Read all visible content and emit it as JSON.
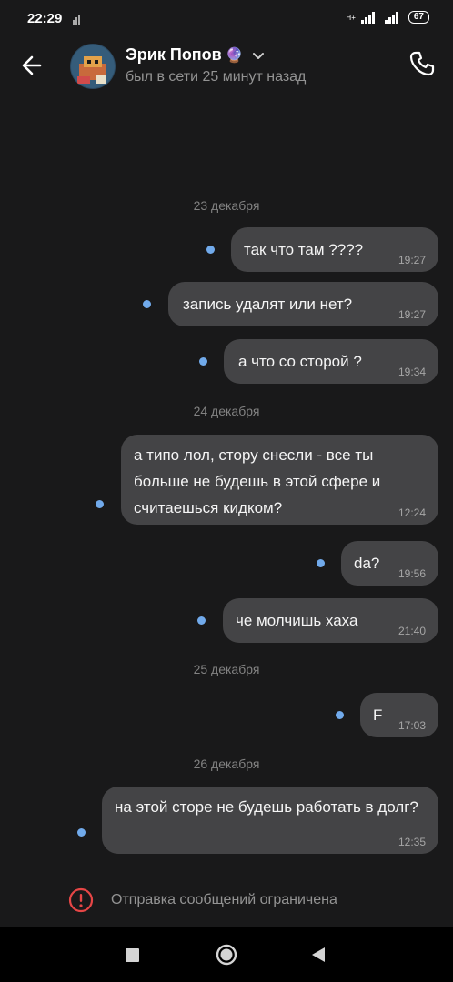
{
  "status_bar": {
    "time": "22:29",
    "network_small": "H+",
    "battery": "67"
  },
  "header": {
    "contact_name": "Эрик Попов",
    "contact_emoji": "🔮",
    "last_seen": "был в сети 25 минут назад",
    "icons": [
      "arrow-back-icon",
      "avatar",
      "chevron-down-icon",
      "phone-icon"
    ]
  },
  "chat": {
    "dates": [
      "23 декабря",
      "24 декабря",
      "25 декабря",
      "26 декабря"
    ],
    "messages": [
      {
        "text": "так что там ????",
        "time": "19:27",
        "unread": true
      },
      {
        "text": "запись удалят или нет?",
        "time": "19:27",
        "unread": true
      },
      {
        "text": "а что со сторой ?",
        "time": "19:34",
        "unread": true
      },
      {
        "text": "а типо лол, стору снесли - все ты больше не будешь в этой сфере и считаешься кидком?",
        "time": "12:24",
        "unread": true
      },
      {
        "text": "da?",
        "time": "19:56",
        "unread": true
      },
      {
        "text": "че молчишь хаха",
        "time": "21:40",
        "unread": true
      },
      {
        "text": "F",
        "time": "17:03",
        "unread": true
      },
      {
        "text": "на этой сторе не будешь работать в долг?",
        "time": "12:35",
        "unread": true
      }
    ]
  },
  "restriction": {
    "text": "Отправка сообщений ограничена",
    "icon": "exclamation-circle-icon",
    "color": "#e64646"
  },
  "colors": {
    "background": "#19191a",
    "bubble": "#444446",
    "unread_dot": "#71aaeb"
  }
}
